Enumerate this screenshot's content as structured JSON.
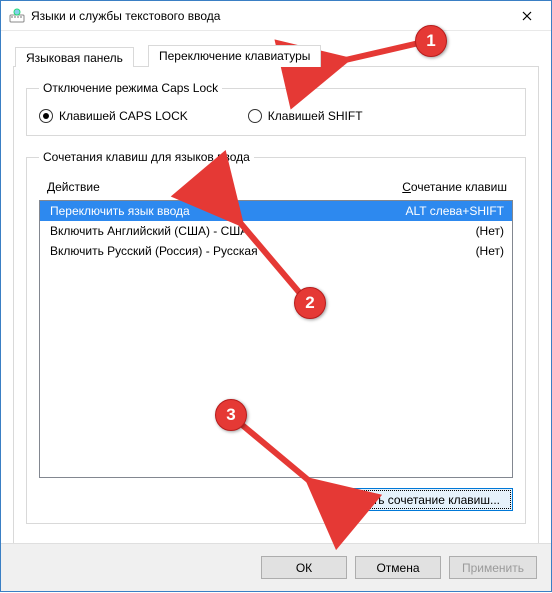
{
  "window": {
    "title": "Языки и службы текстового ввода"
  },
  "tabs": {
    "language_panel": "Языковая панель",
    "keyboard_switch": "Переключение клавиатуры"
  },
  "capslock": {
    "legend": "Отключение режима Caps Lock",
    "opt_caps": "Клавишей CAPS LOCK",
    "opt_shift": "Клавишей SHIFT"
  },
  "hotkeys": {
    "legend": "Сочетания клавиш для языков ввода",
    "col_action": "Действие",
    "col_keys": "Сочетание клавиш",
    "rows": [
      {
        "action": "Переключить язык ввода",
        "keys": "ALT слева+SHIFT",
        "selected": true
      },
      {
        "action": "Включить Английский (США) - США",
        "keys": "(Нет)",
        "selected": false
      },
      {
        "action": "Включить Русский (Россия) - Русская",
        "keys": "(Нет)",
        "selected": false
      }
    ],
    "change_button": "Сменить сочетание клавиш..."
  },
  "buttons": {
    "ok": "ОК",
    "cancel": "Отмена",
    "apply": "Применить"
  },
  "annotations": {
    "b1": "1",
    "b2": "2",
    "b3": "3"
  }
}
